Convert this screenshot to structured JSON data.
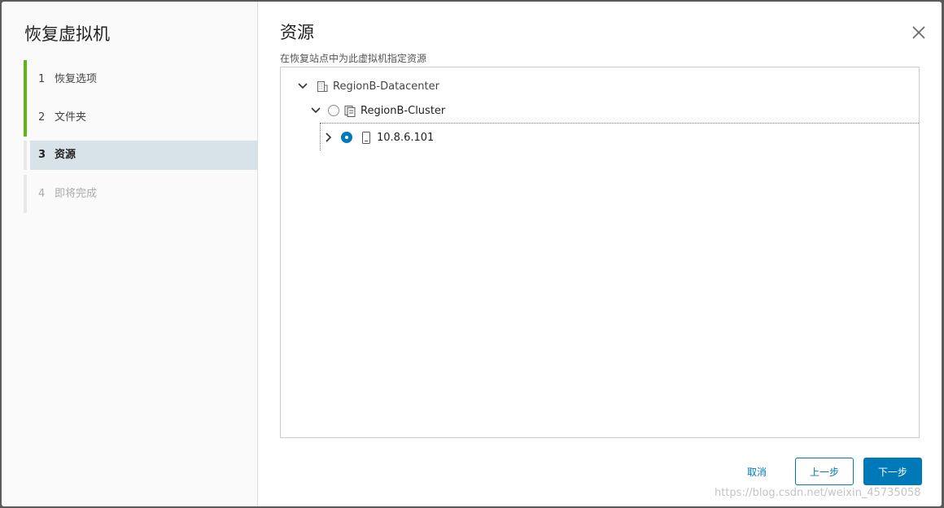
{
  "wizard": {
    "title": "恢复虚拟机",
    "steps": [
      {
        "num": "1",
        "label": "恢复选项"
      },
      {
        "num": "2",
        "label": "文件夹"
      },
      {
        "num": "3",
        "label": "资源"
      },
      {
        "num": "4",
        "label": "即将完成"
      }
    ]
  },
  "main": {
    "title": "资源",
    "subtitle": "在恢复站点中为此虚拟机指定资源"
  },
  "tree": {
    "datacenter": "RegionB-Datacenter",
    "cluster": "RegionB-Cluster",
    "host": "10.8.6.101"
  },
  "buttons": {
    "cancel": "取消",
    "prev": "上一步",
    "next": "下一步"
  },
  "watermark": "https://blog.csdn.net/weixin_45735058",
  "colors": {
    "accent": "#0079b8",
    "step_done": "#60b515",
    "active_step_bg": "#d8e3e9"
  }
}
